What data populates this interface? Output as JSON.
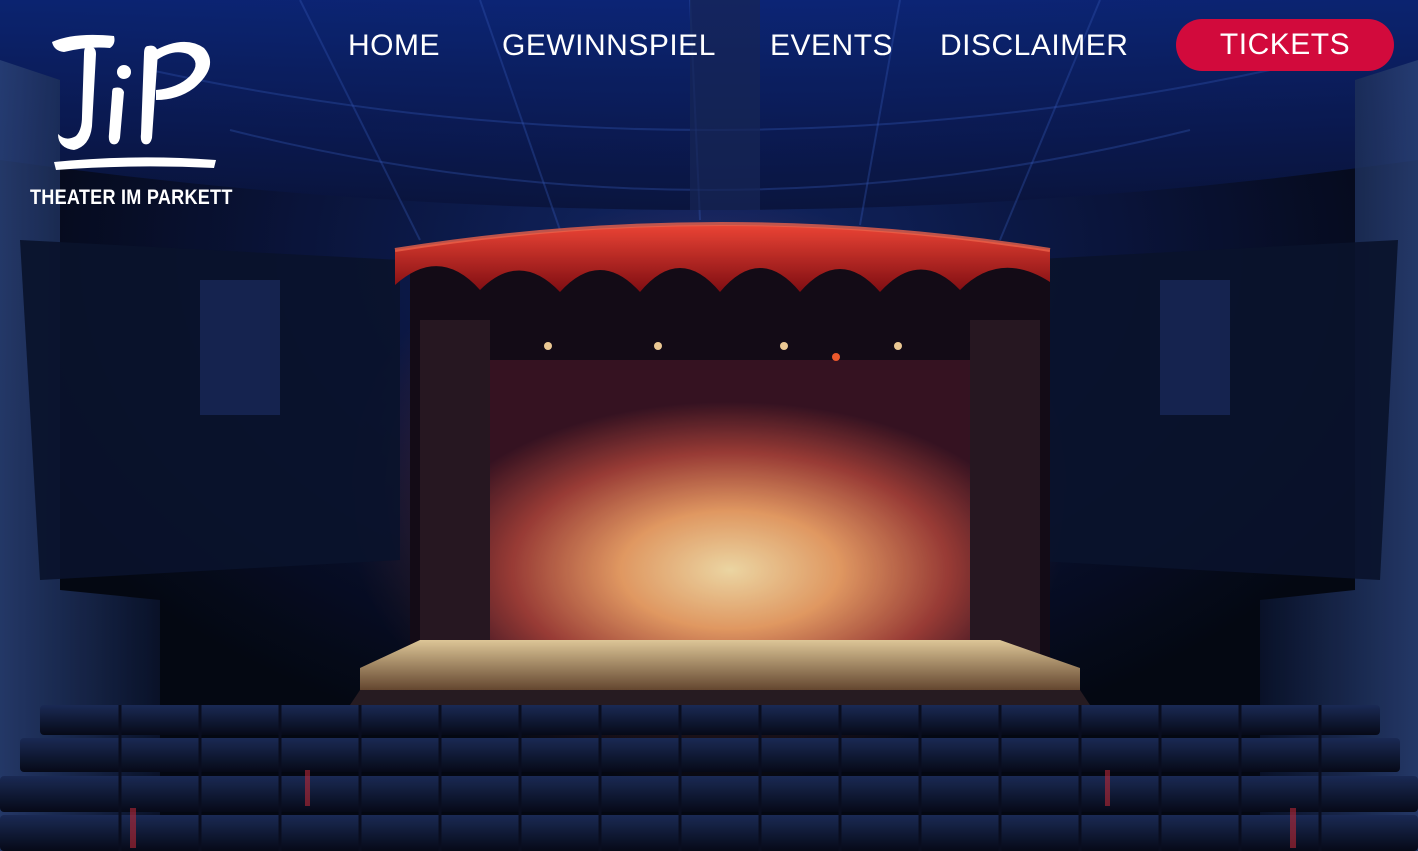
{
  "site": {
    "logo_mark": "TiP",
    "logo_subtitle": "THEATER IM PARKETT"
  },
  "nav": {
    "items": [
      {
        "label": "HOME"
      },
      {
        "label": "GEWINNSPIEL"
      },
      {
        "label": "EVENTS"
      },
      {
        "label": "DISCLAIMER"
      }
    ],
    "cta": {
      "label": "TICKETS"
    }
  },
  "colors": {
    "cta_background": "#d20a3c",
    "nav_text": "#ffffff"
  },
  "icons": {
    "logo": "tip-logo-icon",
    "hero": "theater-stage-image"
  }
}
